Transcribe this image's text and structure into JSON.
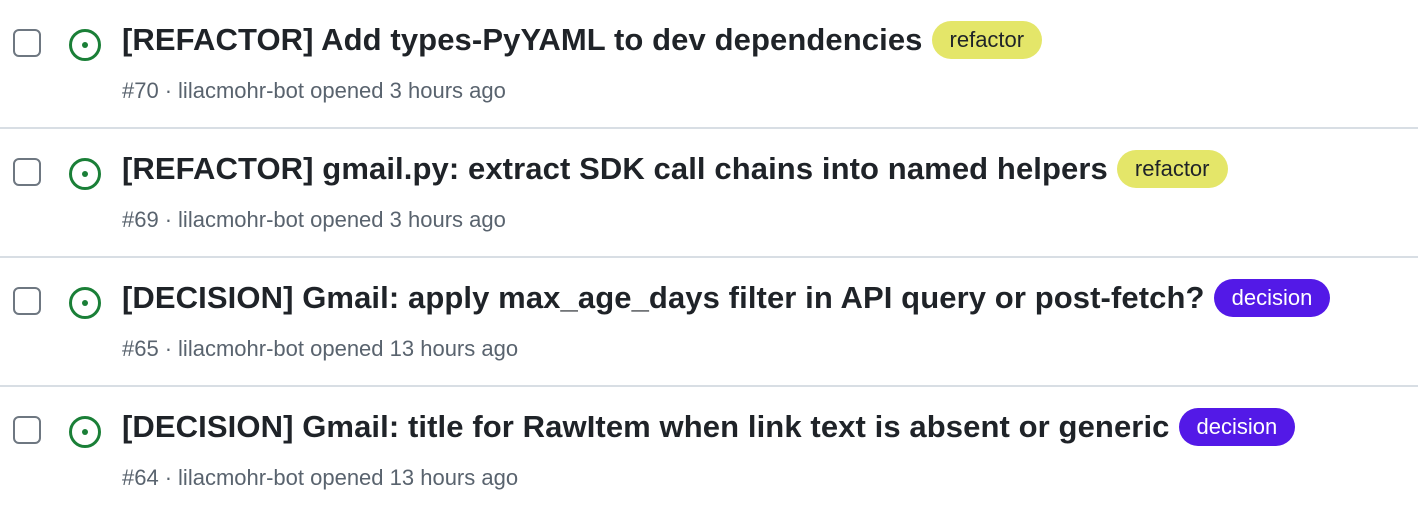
{
  "issues": [
    {
      "title": "[REFACTOR] Add types-PyYAML to dev dependencies",
      "label": "refactor",
      "label_color": "#e4e669",
      "number": "#70",
      "separator": "·",
      "author": "lilacmohr-bot",
      "opened_text": "opened 3 hours ago",
      "status_icon": "issue-opened-icon"
    },
    {
      "title": "[REFACTOR] gmail.py: extract SDK call chains into named helpers",
      "label": "refactor",
      "label_color": "#e4e669",
      "number": "#69",
      "separator": "·",
      "author": "lilacmohr-bot",
      "opened_text": "opened 3 hours ago",
      "status_icon": "issue-opened-icon"
    },
    {
      "title": "[DECISION] Gmail: apply max_age_days filter in API query or post-fetch?",
      "label": "decision",
      "label_color": "#5319e7",
      "number": "#65",
      "separator": "·",
      "author": "lilacmohr-bot",
      "opened_text": "opened 13 hours ago",
      "status_icon": "issue-opened-icon"
    },
    {
      "title": "[DECISION] Gmail: title for RawItem when link text is absent or generic",
      "label": "decision",
      "label_color": "#5319e7",
      "number": "#64",
      "separator": "·",
      "author": "lilacmohr-bot",
      "opened_text": "opened 13 hours ago",
      "status_icon": "issue-opened-icon"
    }
  ],
  "colors": {
    "open_icon": "#1a7f37",
    "text_primary": "#1f2328",
    "text_muted": "#59636e",
    "divider": "#d8dee4"
  }
}
